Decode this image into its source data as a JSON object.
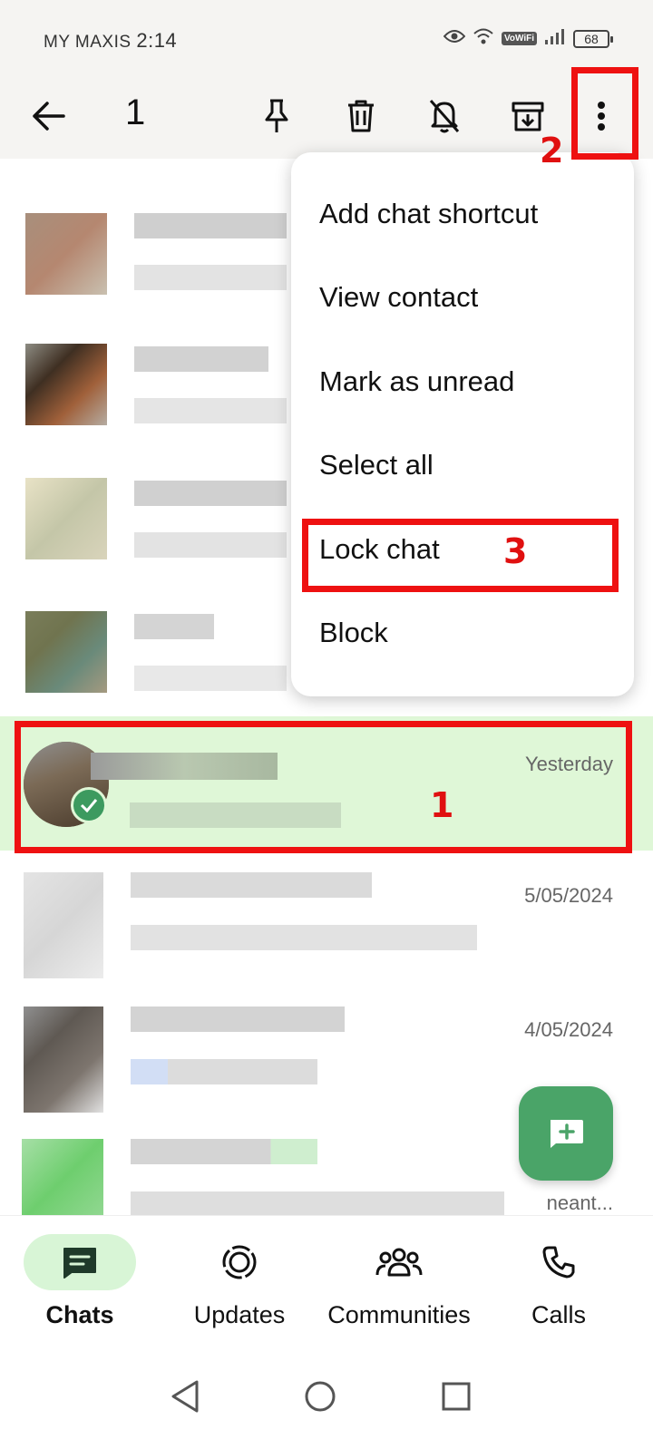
{
  "status_bar": {
    "carrier": "MY MAXIS",
    "time": "2:14",
    "vowifi": "VoWiFi",
    "battery": "68"
  },
  "action_bar": {
    "selected_count": "1"
  },
  "menu": {
    "items": [
      "Add chat shortcut",
      "View contact",
      "Mark as unread",
      "Select all",
      "Lock chat",
      "Block"
    ]
  },
  "chats": {
    "selected_time": "Yesterday",
    "row6_time": "5/05/2024",
    "row7_time": "4/05/2024",
    "row8_preview": "neant..."
  },
  "annotations": {
    "one": "1",
    "two": "2",
    "three": "3"
  },
  "bottom_nav": {
    "chats": "Chats",
    "updates": "Updates",
    "communities": "Communities",
    "calls": "Calls"
  },
  "colors": {
    "accent_green": "#4aa468",
    "selection_bg": "#dff7d7",
    "annotation_red": "#ee1111"
  }
}
